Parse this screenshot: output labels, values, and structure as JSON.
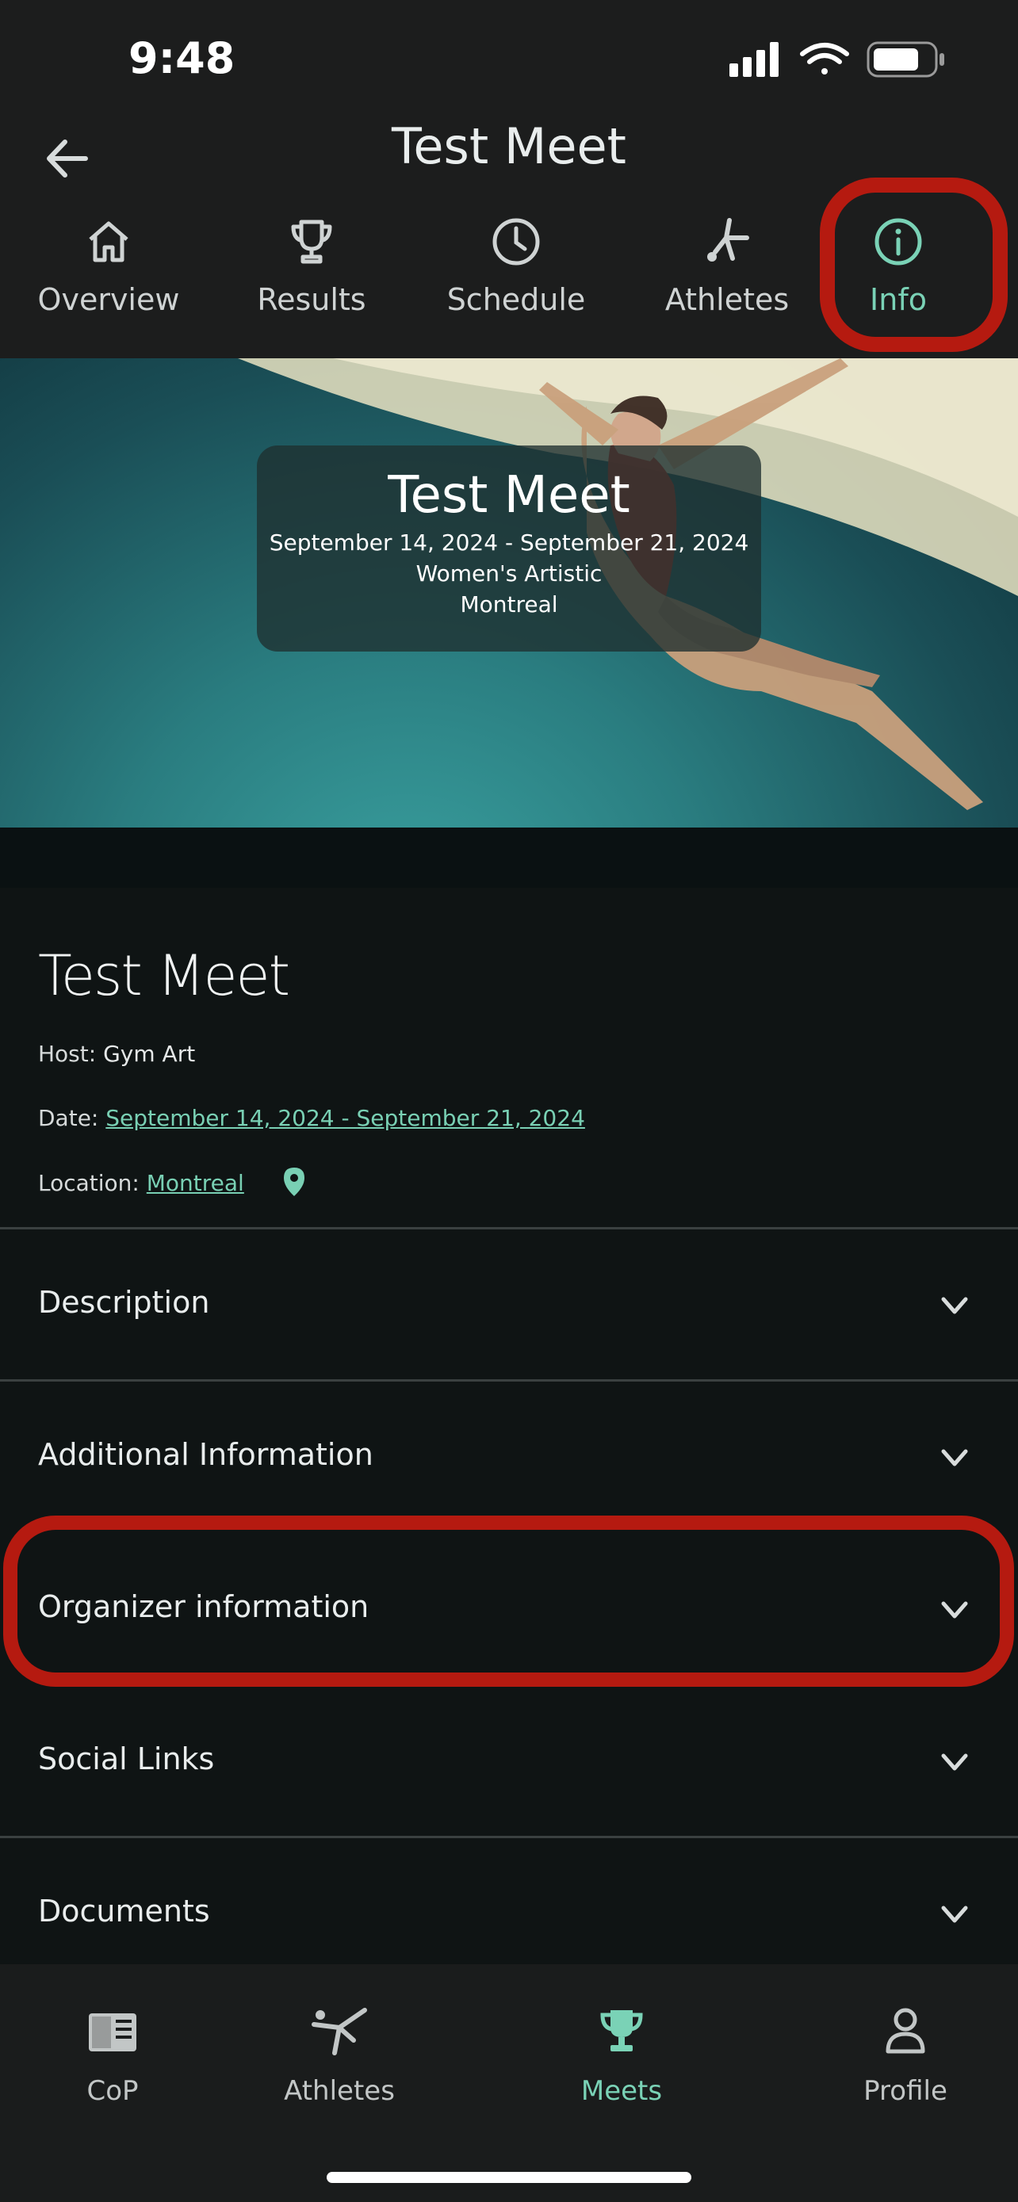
{
  "status_bar": {
    "time": "9:48"
  },
  "header": {
    "title": "Test Meet"
  },
  "tabs": [
    {
      "label": "Overview",
      "icon": "home-icon"
    },
    {
      "label": "Results",
      "icon": "trophy-icon"
    },
    {
      "label": "Schedule",
      "icon": "clock-icon"
    },
    {
      "label": "Athletes",
      "icon": "gymnast-icon"
    },
    {
      "label": "Info",
      "icon": "info-icon",
      "active": true
    }
  ],
  "hero": {
    "title": "Test Meet",
    "dates": "September 14, 2024 - September 21, 2024",
    "discipline": "Women's Artistic",
    "city": "Montreal"
  },
  "details": {
    "title": "Test Meet",
    "host_label": "Host:",
    "host_value": "Gym Art",
    "date_label": "Date:",
    "date_value": "September 14, 2024 - September 21, 2024",
    "location_label": "Location:",
    "location_value": "Montreal"
  },
  "sections": [
    {
      "label": "Description"
    },
    {
      "label": "Additional Information"
    },
    {
      "label": "Organizer information"
    },
    {
      "label": "Social Links"
    },
    {
      "label": "Documents"
    }
  ],
  "bottom_nav": [
    {
      "label": "CoP",
      "icon": "book-icon"
    },
    {
      "label": "Athletes",
      "icon": "gymnast-icon"
    },
    {
      "label": "Meets",
      "icon": "trophy-icon",
      "active": true
    },
    {
      "label": "Profile",
      "icon": "person-icon"
    }
  ],
  "colors": {
    "accent": "#7ad2b6",
    "highlight": "#b51a10",
    "background": "#0f1414",
    "header_bg": "#1c1d1d"
  }
}
